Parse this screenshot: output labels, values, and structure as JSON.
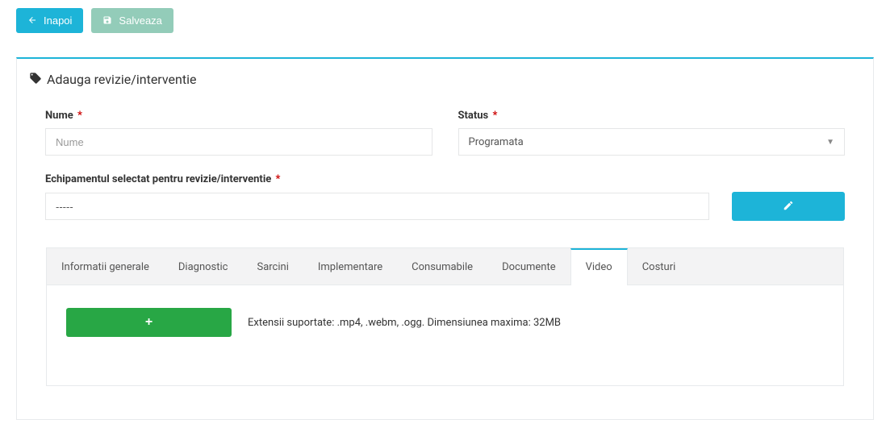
{
  "toolbar": {
    "back_label": "Inapoi",
    "save_label": "Salveaza"
  },
  "page": {
    "title": "Adauga revizie/interventie"
  },
  "form": {
    "name": {
      "label": "Nume",
      "required": "*",
      "placeholder": "Nume",
      "value": ""
    },
    "status": {
      "label": "Status",
      "required": "*",
      "selected": "Programata"
    },
    "equipment": {
      "label": "Echipamentul selectat pentru revizie/interventie",
      "required": "*",
      "value": "-----"
    }
  },
  "tabs": {
    "items": [
      {
        "label": "Informatii generale"
      },
      {
        "label": "Diagnostic"
      },
      {
        "label": "Sarcini"
      },
      {
        "label": "Implementare"
      },
      {
        "label": "Consumabile"
      },
      {
        "label": "Documente"
      },
      {
        "label": "Video"
      },
      {
        "label": "Costuri"
      }
    ],
    "active_index": 6
  },
  "video_tab": {
    "help_text": "Extensii suportate: .mp4, .webm, .ogg. Dimensiunea maxima: 32MB"
  }
}
